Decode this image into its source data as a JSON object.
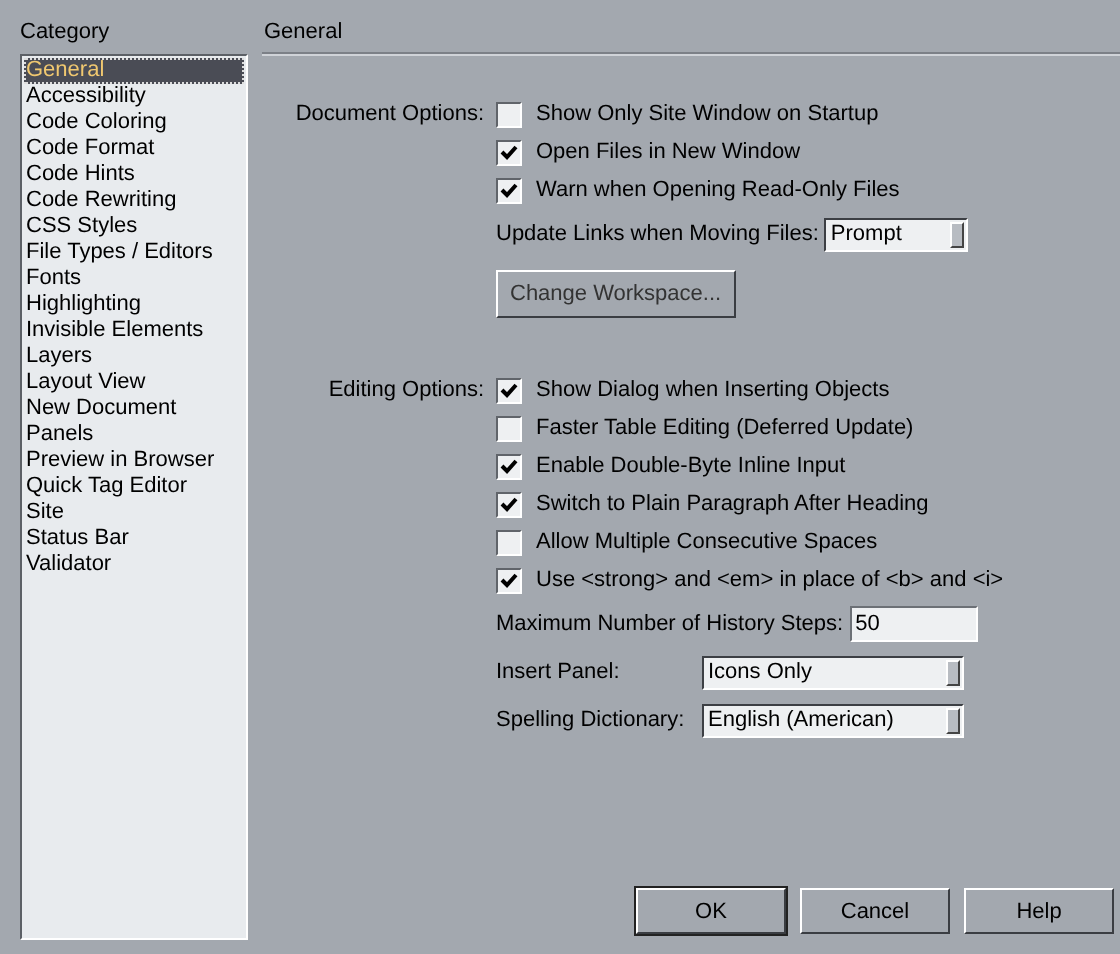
{
  "sidebar": {
    "heading": "Category",
    "items": [
      {
        "label": "General",
        "selected": true
      },
      {
        "label": "Accessibility",
        "selected": false
      },
      {
        "label": "Code Coloring",
        "selected": false
      },
      {
        "label": "Code Format",
        "selected": false
      },
      {
        "label": "Code Hints",
        "selected": false
      },
      {
        "label": "Code Rewriting",
        "selected": false
      },
      {
        "label": "CSS Styles",
        "selected": false
      },
      {
        "label": "File Types / Editors",
        "selected": false
      },
      {
        "label": "Fonts",
        "selected": false
      },
      {
        "label": "Highlighting",
        "selected": false
      },
      {
        "label": "Invisible Elements",
        "selected": false
      },
      {
        "label": "Layers",
        "selected": false
      },
      {
        "label": "Layout View",
        "selected": false
      },
      {
        "label": "New Document",
        "selected": false
      },
      {
        "label": "Panels",
        "selected": false
      },
      {
        "label": "Preview in Browser",
        "selected": false
      },
      {
        "label": "Quick Tag Editor",
        "selected": false
      },
      {
        "label": "Site",
        "selected": false
      },
      {
        "label": "Status Bar",
        "selected": false
      },
      {
        "label": "Validator",
        "selected": false
      }
    ]
  },
  "panel": {
    "title": "General",
    "document_options": {
      "label": "Document Options:",
      "checkboxes": [
        {
          "label": "Show Only Site Window on Startup",
          "checked": false
        },
        {
          "label": "Open Files in New Window",
          "checked": true
        },
        {
          "label": "Warn when Opening Read-Only Files",
          "checked": true
        }
      ],
      "update_links": {
        "label": "Update Links when Moving Files:",
        "value": "Prompt"
      },
      "change_workspace_button": "Change Workspace..."
    },
    "editing_options": {
      "label": "Editing Options:",
      "checkboxes": [
        {
          "label": "Show Dialog when Inserting Objects",
          "checked": true
        },
        {
          "label": "Faster Table Editing (Deferred Update)",
          "checked": false
        },
        {
          "label": "Enable Double-Byte Inline Input",
          "checked": true
        },
        {
          "label": "Switch to Plain Paragraph After Heading",
          "checked": true
        },
        {
          "label": "Allow Multiple Consecutive Spaces",
          "checked": false
        },
        {
          "label": "Use <strong> and <em> in place of <b> and <i>",
          "checked": true
        }
      ],
      "history_steps": {
        "label": "Maximum Number of History Steps:",
        "value": "50"
      },
      "insert_panel": {
        "label": "Insert Panel:",
        "value": "Icons Only"
      },
      "spelling_dictionary": {
        "label": "Spelling Dictionary:",
        "value": "English (American)"
      }
    }
  },
  "buttons": [
    "OK",
    "Cancel",
    "Help"
  ]
}
